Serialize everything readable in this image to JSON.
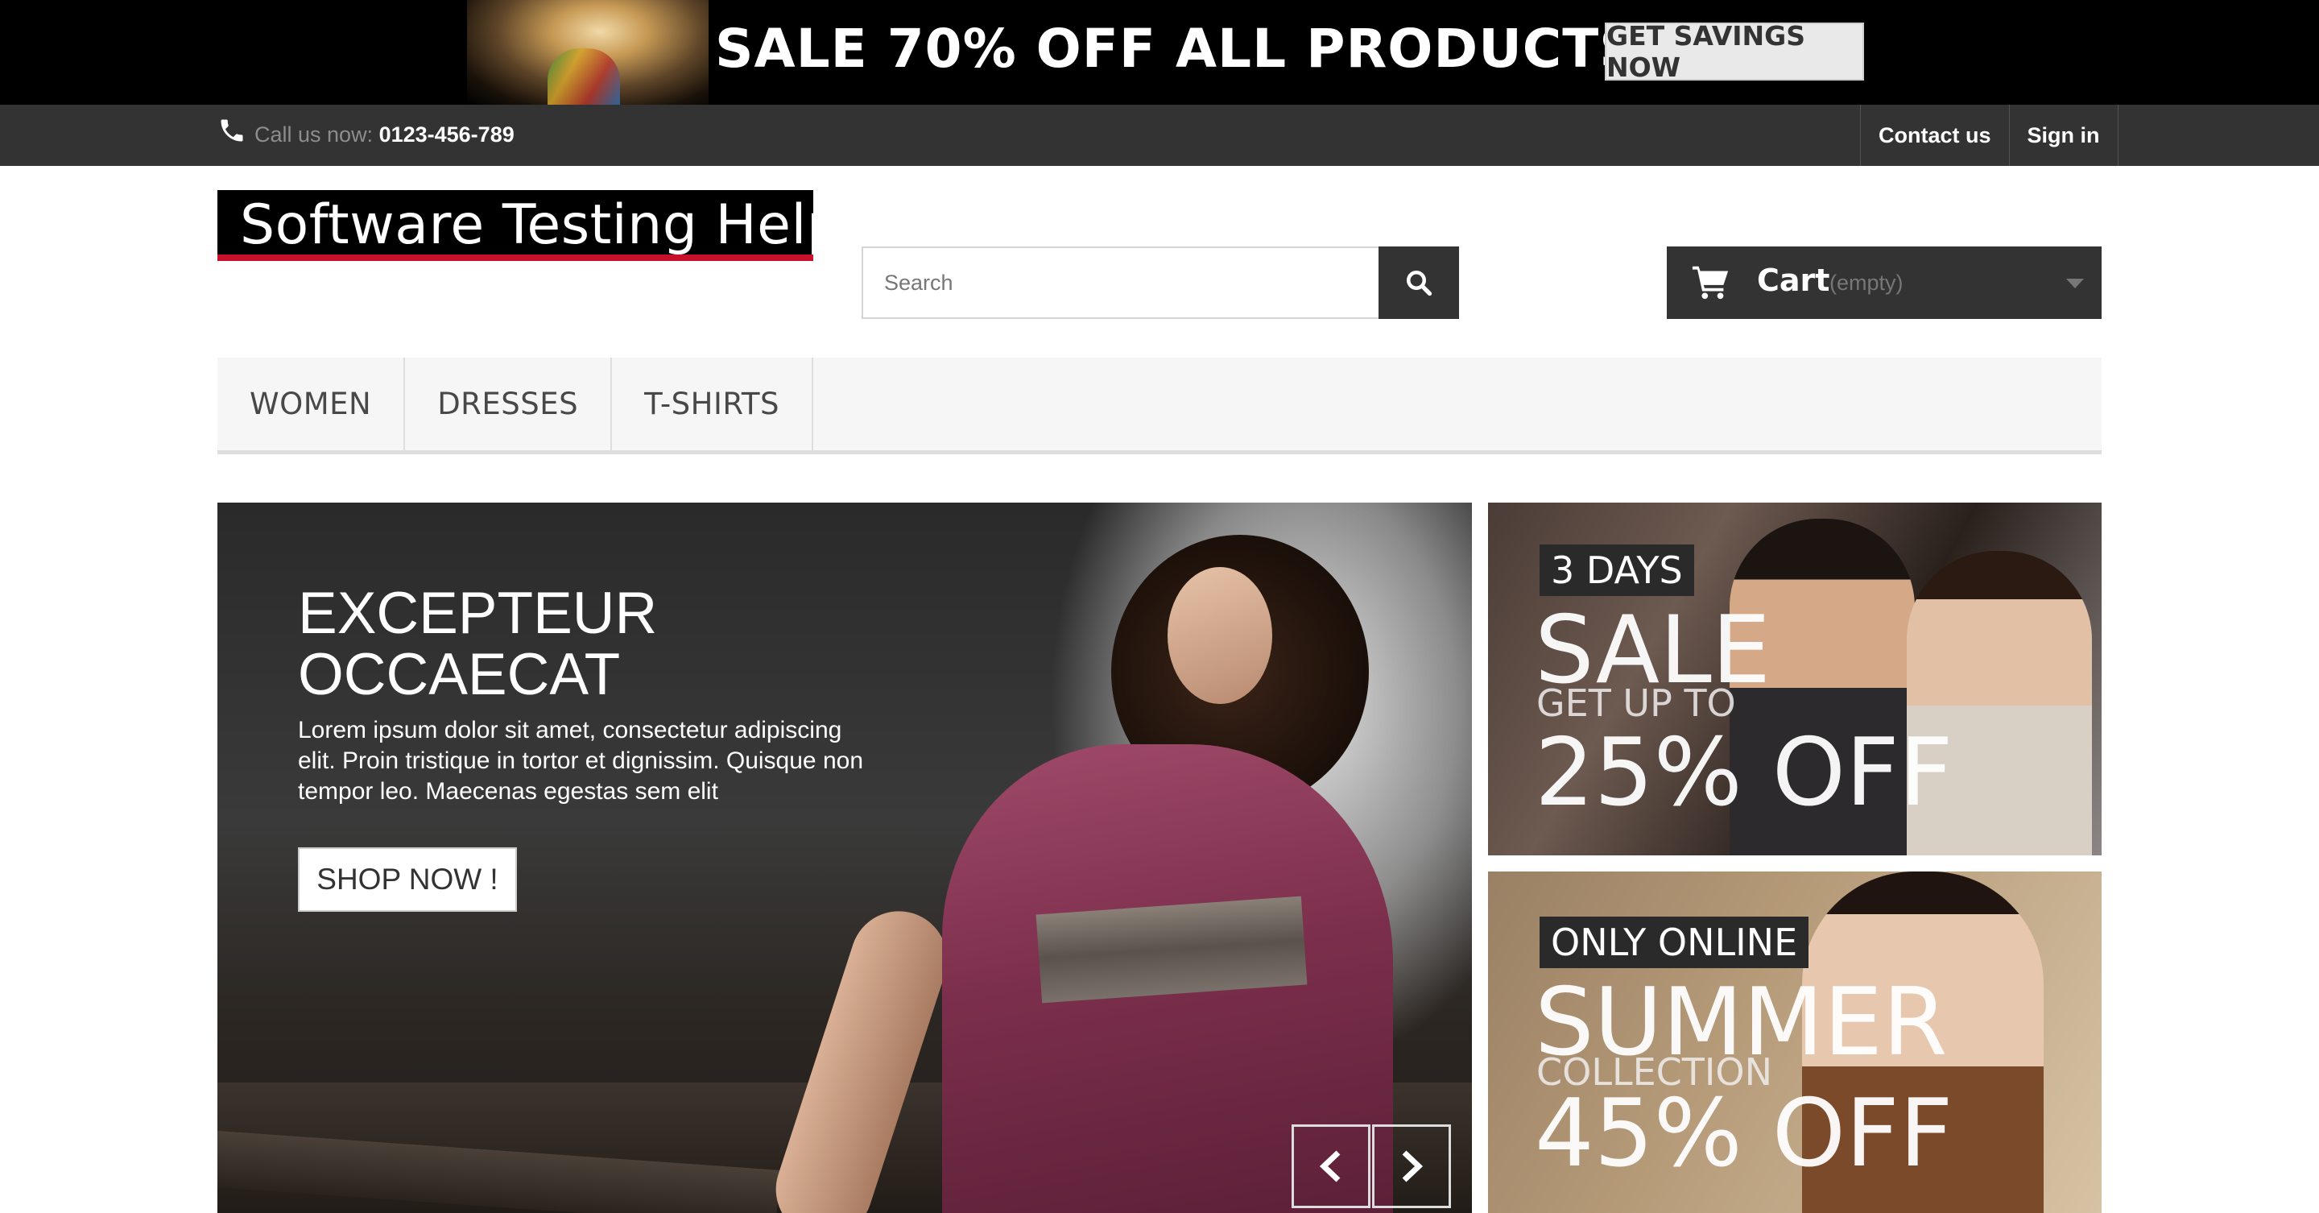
{
  "promo": {
    "text": "SALE 70% OFF ALL PRODUCTS",
    "button": "GET SAVINGS NOW"
  },
  "navbar": {
    "call_label": "Call us now: ",
    "phone": "0123-456-789",
    "links": [
      "Contact us",
      "Sign in"
    ]
  },
  "header": {
    "logo": "Software Testing Help",
    "search_placeholder": "Search",
    "cart_label": "Cart",
    "cart_status": "(empty)"
  },
  "menu": [
    "WOMEN",
    "DRESSES",
    "T-SHIRTS"
  ],
  "slider": {
    "title": "EXCEPTEUR\nOCCAECAT",
    "description": "Lorem ipsum dolor sit amet, consectetur adipiscing elit. Proin tristique in tortor et dignissim. Quisque non tempor leo. Maecenas egestas sem elit",
    "button": "SHOP NOW !"
  },
  "banners": [
    {
      "tag": "3 DAYS",
      "big": "SALE",
      "mid": "GET UP TO",
      "offer": "25% OFF"
    },
    {
      "tag": "ONLY ONLINE",
      "big": "SUMMER",
      "mid": "COLLECTION",
      "offer": "45% OFF"
    }
  ],
  "colors": {
    "dark": "#333333",
    "accent_red": "#c8102e",
    "menu_bg": "#f6f6f6"
  }
}
